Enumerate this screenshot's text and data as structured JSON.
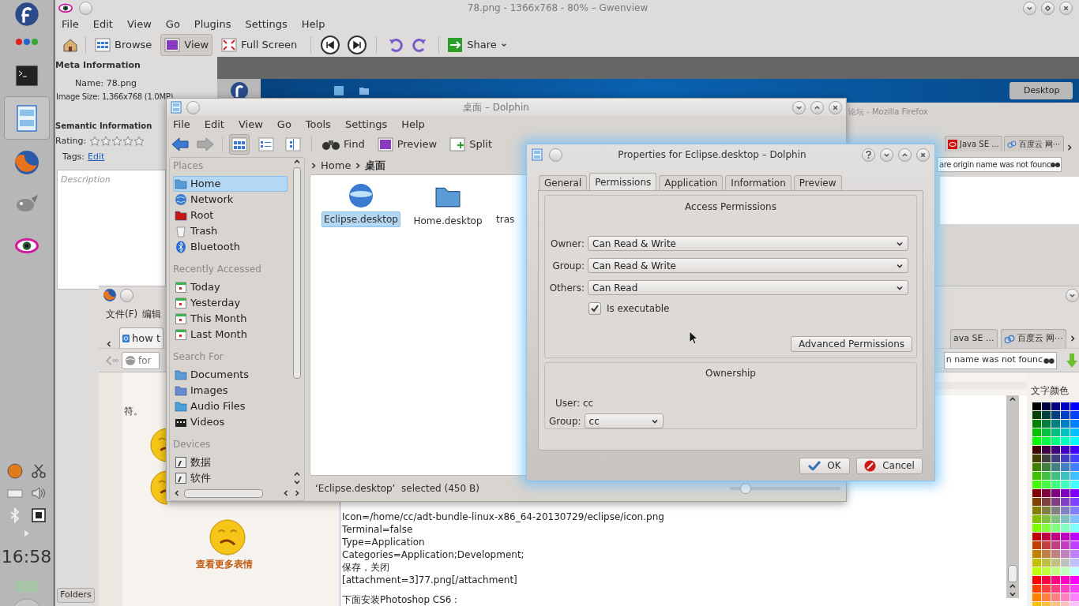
{
  "panel": {
    "clock": "16:58"
  },
  "gwenview": {
    "title": "78.png - 1366x768 - 80% – Gwenview",
    "menu": [
      "File",
      "Edit",
      "View",
      "Go",
      "Plugins",
      "Settings",
      "Help"
    ],
    "toolbar": [
      {
        "label": "Browse",
        "selected": false
      },
      {
        "label": "View",
        "selected": true
      },
      {
        "label": "Full Screen",
        "selected": false
      },
      {
        "label": "Share",
        "selected": false
      }
    ],
    "meta_title": "Meta Information",
    "name_line": "Name: 78.png",
    "size_line": "Image Size: 1,366x768 (1.0MP)",
    "semantic_title": "Semantic Information",
    "rating_label": "Rating:",
    "stars": 0,
    "tags_label": "Tags:",
    "tags_link": "Edit",
    "description_placeholder": "Description",
    "folders_button": "Folders"
  },
  "nested_screen": {
    "desktop_button": "Desktop"
  },
  "firefox_top": {
    "title": "论坛 - Mozilla Firefox",
    "tabs": [
      {
        "label": "Java SE ...",
        "selected": false
      },
      {
        "label": "百度云 网⋯",
        "selected": false
      }
    ],
    "search": "are origin name was not founc"
  },
  "firefox": {
    "menu": [
      "文件(F)",
      "编辑"
    ],
    "tabs": [
      {
        "label": "how t",
        "selected": true
      },
      {
        "label": "ava SE ...",
        "selected": false
      },
      {
        "label": "百度云 网⋯",
        "selected": false
      }
    ],
    "address": "for",
    "search": "n name was not founc",
    "content_text": "符。",
    "more_emoticons": "查看更多表情",
    "post_paragraphs": [
      [
        "Icon=/home/cc/adt-bundle-linux-x86_64-20130729/eclipse/icon.png",
        "Terminal=false",
        "Type=Application",
        "Categories=Application;Development;",
        "保存，关闭",
        "[attachment=3]77.png[/attachment]"
      ],
      [
        "下面安装Photoshop CS6："
      ]
    ],
    "palette_title": "文字颜色"
  },
  "dolphin": {
    "title": "桌面 – Dolphin",
    "menu": [
      "File",
      "Edit",
      "View",
      "Go",
      "Tools",
      "Settings",
      "Help"
    ],
    "view_modes": [
      {
        "selected": true
      },
      {
        "selected": false
      },
      {
        "selected": false
      }
    ],
    "toolbar": [
      "Find",
      "Preview",
      "Split"
    ],
    "places": [
      {
        "heading": "Places",
        "items": [
          {
            "label": "Home",
            "selected": true
          },
          {
            "label": "Network",
            "selected": false
          },
          {
            "label": "Root",
            "selected": false
          },
          {
            "label": "Trash",
            "selected": false
          },
          {
            "label": "Bluetooth",
            "selected": false
          }
        ]
      },
      {
        "heading": "Recently Accessed",
        "items": [
          {
            "label": "Today",
            "selected": false
          },
          {
            "label": "Yesterday",
            "selected": false
          },
          {
            "label": "This Month",
            "selected": false
          },
          {
            "label": "Last Month",
            "selected": false
          }
        ]
      },
      {
        "heading": "Search For",
        "items": [
          {
            "label": "Documents",
            "selected": false
          },
          {
            "label": "Images",
            "selected": false
          },
          {
            "label": "Audio Files",
            "selected": false
          },
          {
            "label": "Videos",
            "selected": false
          }
        ]
      },
      {
        "heading": "Devices",
        "items": [
          {
            "label": "数据",
            "selected": false
          },
          {
            "label": "软件",
            "selected": false
          }
        ]
      }
    ],
    "breadcrumb": [
      "Home",
      "桌面"
    ],
    "files": [
      {
        "label": "Eclipse.desktop",
        "selected": true
      },
      {
        "label": "Home.desktop",
        "selected": false
      },
      {
        "label": "tras",
        "selected": false
      }
    ],
    "status": "‘Eclipse.desktop’  selected (450 B)",
    "zoom": {
      "level": 0.14
    }
  },
  "dialog": {
    "title": "Properties for Eclipse.desktop – Dolphin",
    "tabs": [
      {
        "label": "General",
        "selected": false
      },
      {
        "label": "Permissions",
        "selected": true
      },
      {
        "label": "Application",
        "selected": false
      },
      {
        "label": "Information",
        "selected": false
      },
      {
        "label": "Preview",
        "selected": false
      }
    ],
    "access_title": "Access Permissions",
    "rows": [
      {
        "label": "Owner:",
        "value": "Can Read & Write"
      },
      {
        "label": "Group:",
        "value": "Can Read & Write"
      },
      {
        "label": "Others:",
        "value": "Can Read"
      }
    ],
    "executable": {
      "label": "Is executable",
      "checked": true
    },
    "advanced_button": "Advanced Permissions",
    "ownership_title": "Ownership",
    "user": "User: cc",
    "group_label": "Group:",
    "group_value": "cc",
    "ok": "OK",
    "cancel": "Cancel"
  }
}
